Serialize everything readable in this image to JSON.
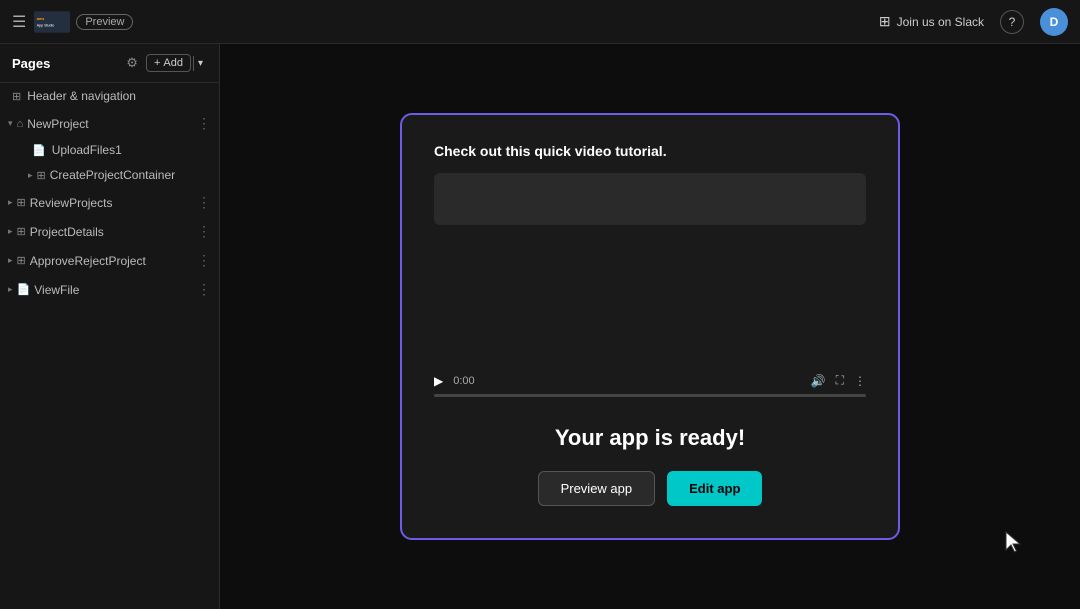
{
  "topnav": {
    "hamburger_label": "☰",
    "app_name": "App Studio",
    "preview_badge": "Preview",
    "slack_label": "Join us on Slack",
    "help_label": "?",
    "avatar_label": "D"
  },
  "sidebar": {
    "title": "Pages",
    "add_label": "Add",
    "nav_item": {
      "label": "Header & navigation",
      "icon": "⊞"
    },
    "sections": [
      {
        "id": "new-project",
        "label": "NewProject",
        "icon": "⌂",
        "expanded": true,
        "children": [
          {
            "label": "UploadFiles1",
            "icon": "📄"
          },
          {
            "label": "CreateProjectContainer",
            "icon": "⊞",
            "expanded": true
          }
        ]
      },
      {
        "id": "review-projects",
        "label": "ReviewProjects",
        "icon": "⊞",
        "expanded": false
      },
      {
        "id": "project-details",
        "label": "ProjectDetails",
        "icon": "⊞",
        "expanded": false
      },
      {
        "id": "approve-reject",
        "label": "ApproveRejectProject",
        "icon": "⊞",
        "expanded": false
      },
      {
        "id": "view-file",
        "label": "ViewFile",
        "icon": "📄",
        "expanded": false
      }
    ]
  },
  "modal": {
    "tutorial_text": "Check out this quick video tutorial.",
    "ready_title": "Your app is ready!",
    "preview_btn": "Preview app",
    "edit_btn": "Edit app",
    "time_display": "0:00"
  }
}
